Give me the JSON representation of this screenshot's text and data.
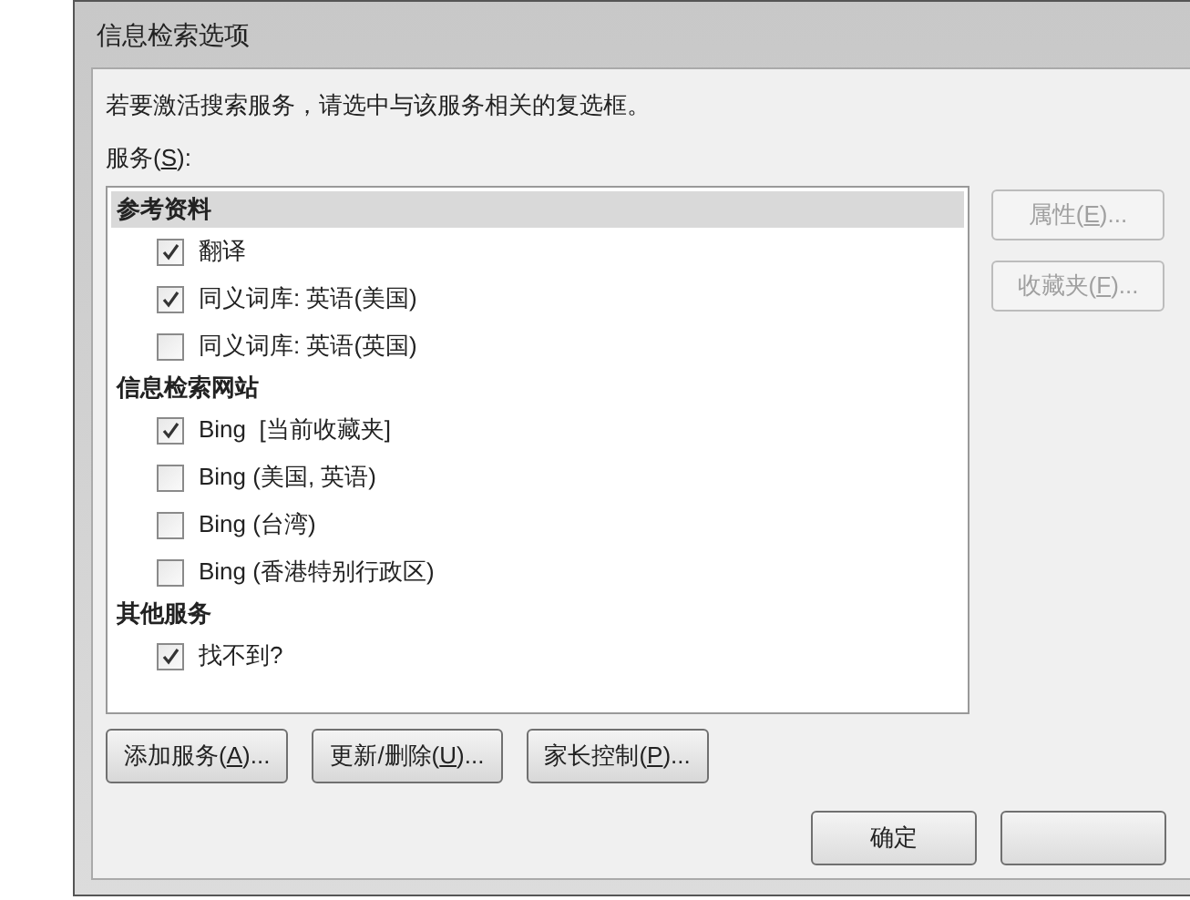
{
  "window": {
    "title": "信息检索选项"
  },
  "instruction": "若要激活搜索服务，请选中与该服务相关的复选框。",
  "services_label": {
    "before": "服务(",
    "key": "S",
    "after": "):"
  },
  "services": [
    {
      "group": "参考资料",
      "selected": true,
      "items": [
        {
          "label": "翻译",
          "checked": true
        },
        {
          "label": "同义词库: 英语(美国)",
          "checked": true
        },
        {
          "label": "同义词库: 英语(英国)",
          "checked": false
        }
      ]
    },
    {
      "group": "信息检索网站",
      "selected": false,
      "items": [
        {
          "label": "Bing  [当前收藏夹]",
          "checked": true
        },
        {
          "label": "Bing (美国, 英语)",
          "checked": false
        },
        {
          "label": "Bing (台湾)",
          "checked": false
        },
        {
          "label": "Bing (香港特别行政区)",
          "checked": false
        }
      ]
    },
    {
      "group": "其他服务",
      "selected": false,
      "items": [
        {
          "label": "找不到?",
          "checked": true
        }
      ]
    }
  ],
  "side_buttons": [
    {
      "before": "属性(",
      "key": "E",
      "after": ")...",
      "disabled": true
    },
    {
      "before": "收藏夹(",
      "key": "F",
      "after": ")...",
      "disabled": true
    }
  ],
  "bottom_buttons": [
    {
      "before": "添加服务(",
      "key": "A",
      "after": ")...",
      "disabled": false
    },
    {
      "before": "更新/删除(",
      "key": "U",
      "after": ")...",
      "disabled": false
    },
    {
      "before": "家长控制(",
      "key": "P",
      "after": ")...",
      "disabled": false
    }
  ],
  "ok_button": "确定"
}
